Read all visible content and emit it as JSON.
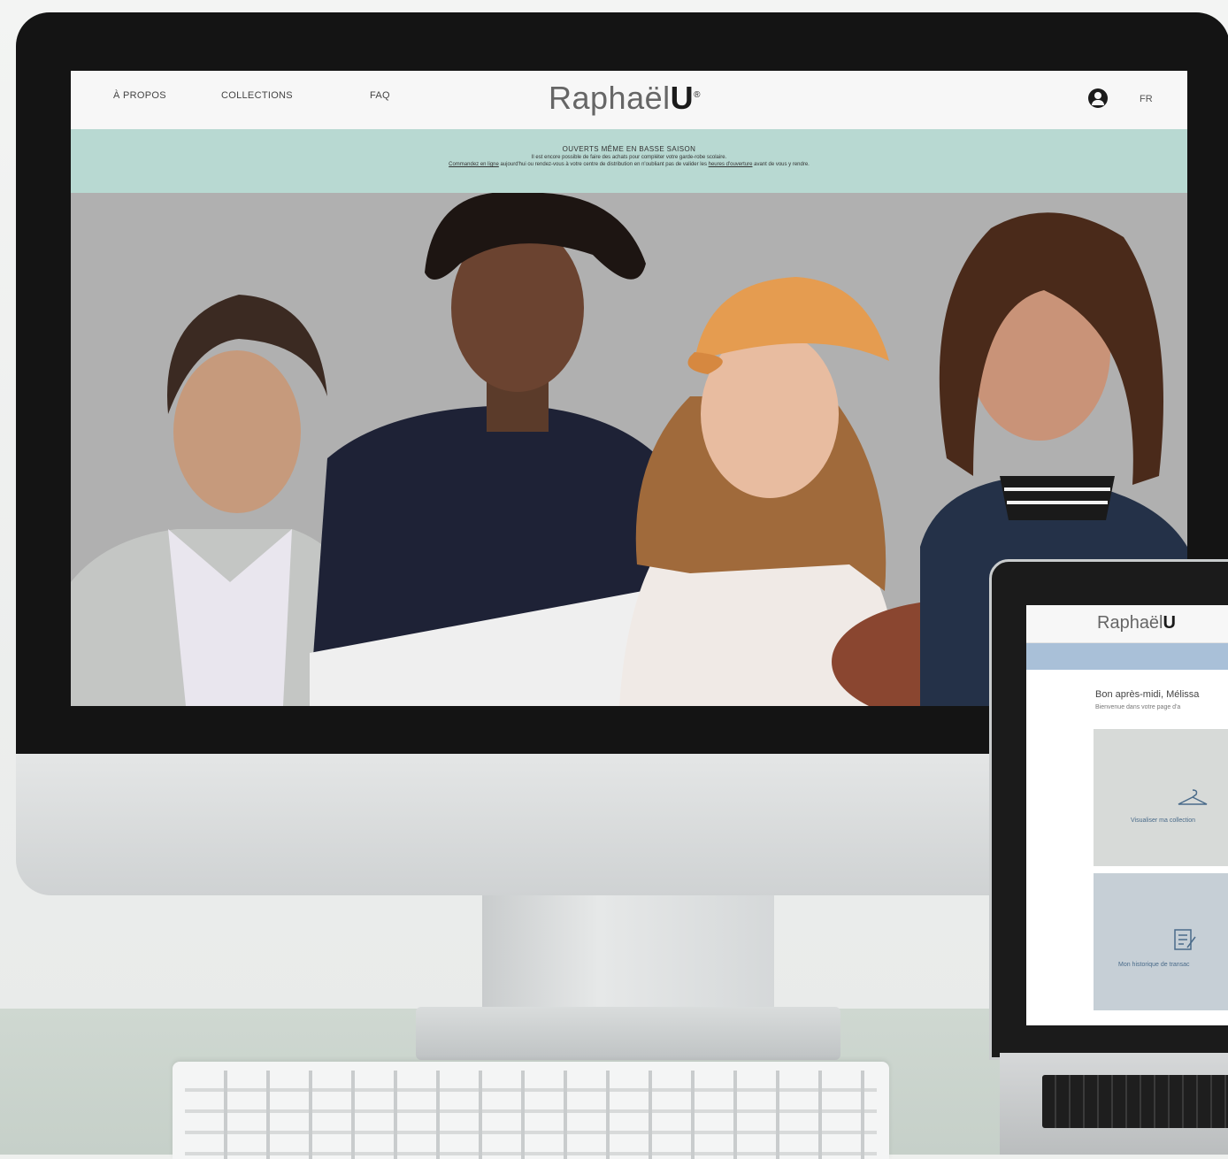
{
  "desktop_site": {
    "nav": {
      "about": "À PROPOS",
      "collections": "COLLECTIONS",
      "faq": "FAQ",
      "logo_main": "Raphaël",
      "logo_bold": "U",
      "lang": "FR",
      "user_icon": "user-circle-icon"
    },
    "banner": {
      "title": "OUVERTS MÊME EN BASSE SAISON",
      "line1": "Il est encore possible de faire des achats pour compléter votre garde-robe scolaire.",
      "line2_link": "Commandez en ligne",
      "line2_mid": " aujourd'hui ou rendez-vous à votre centre de distribution en n'oubliant pas de valider les ",
      "line2_link2": "heures d'ouverture",
      "line2_end": " avant de vous y rendre."
    }
  },
  "laptop_site": {
    "logo_main": "Raphaël",
    "logo_bold": "U",
    "greeting": "Bon après-midi, Mélissa",
    "subtitle": "Bienvenue dans votre page d'a",
    "card1_label": "Visualiser ma collection",
    "card1_icon": "hanger-icon",
    "card2_label": "Mon historique de transac",
    "card2_icon": "history-icon"
  },
  "colors": {
    "banner_bg": "#b8d9d2",
    "laptop_band": "#a9c0d8",
    "nav_bg": "#f7f7f7"
  }
}
